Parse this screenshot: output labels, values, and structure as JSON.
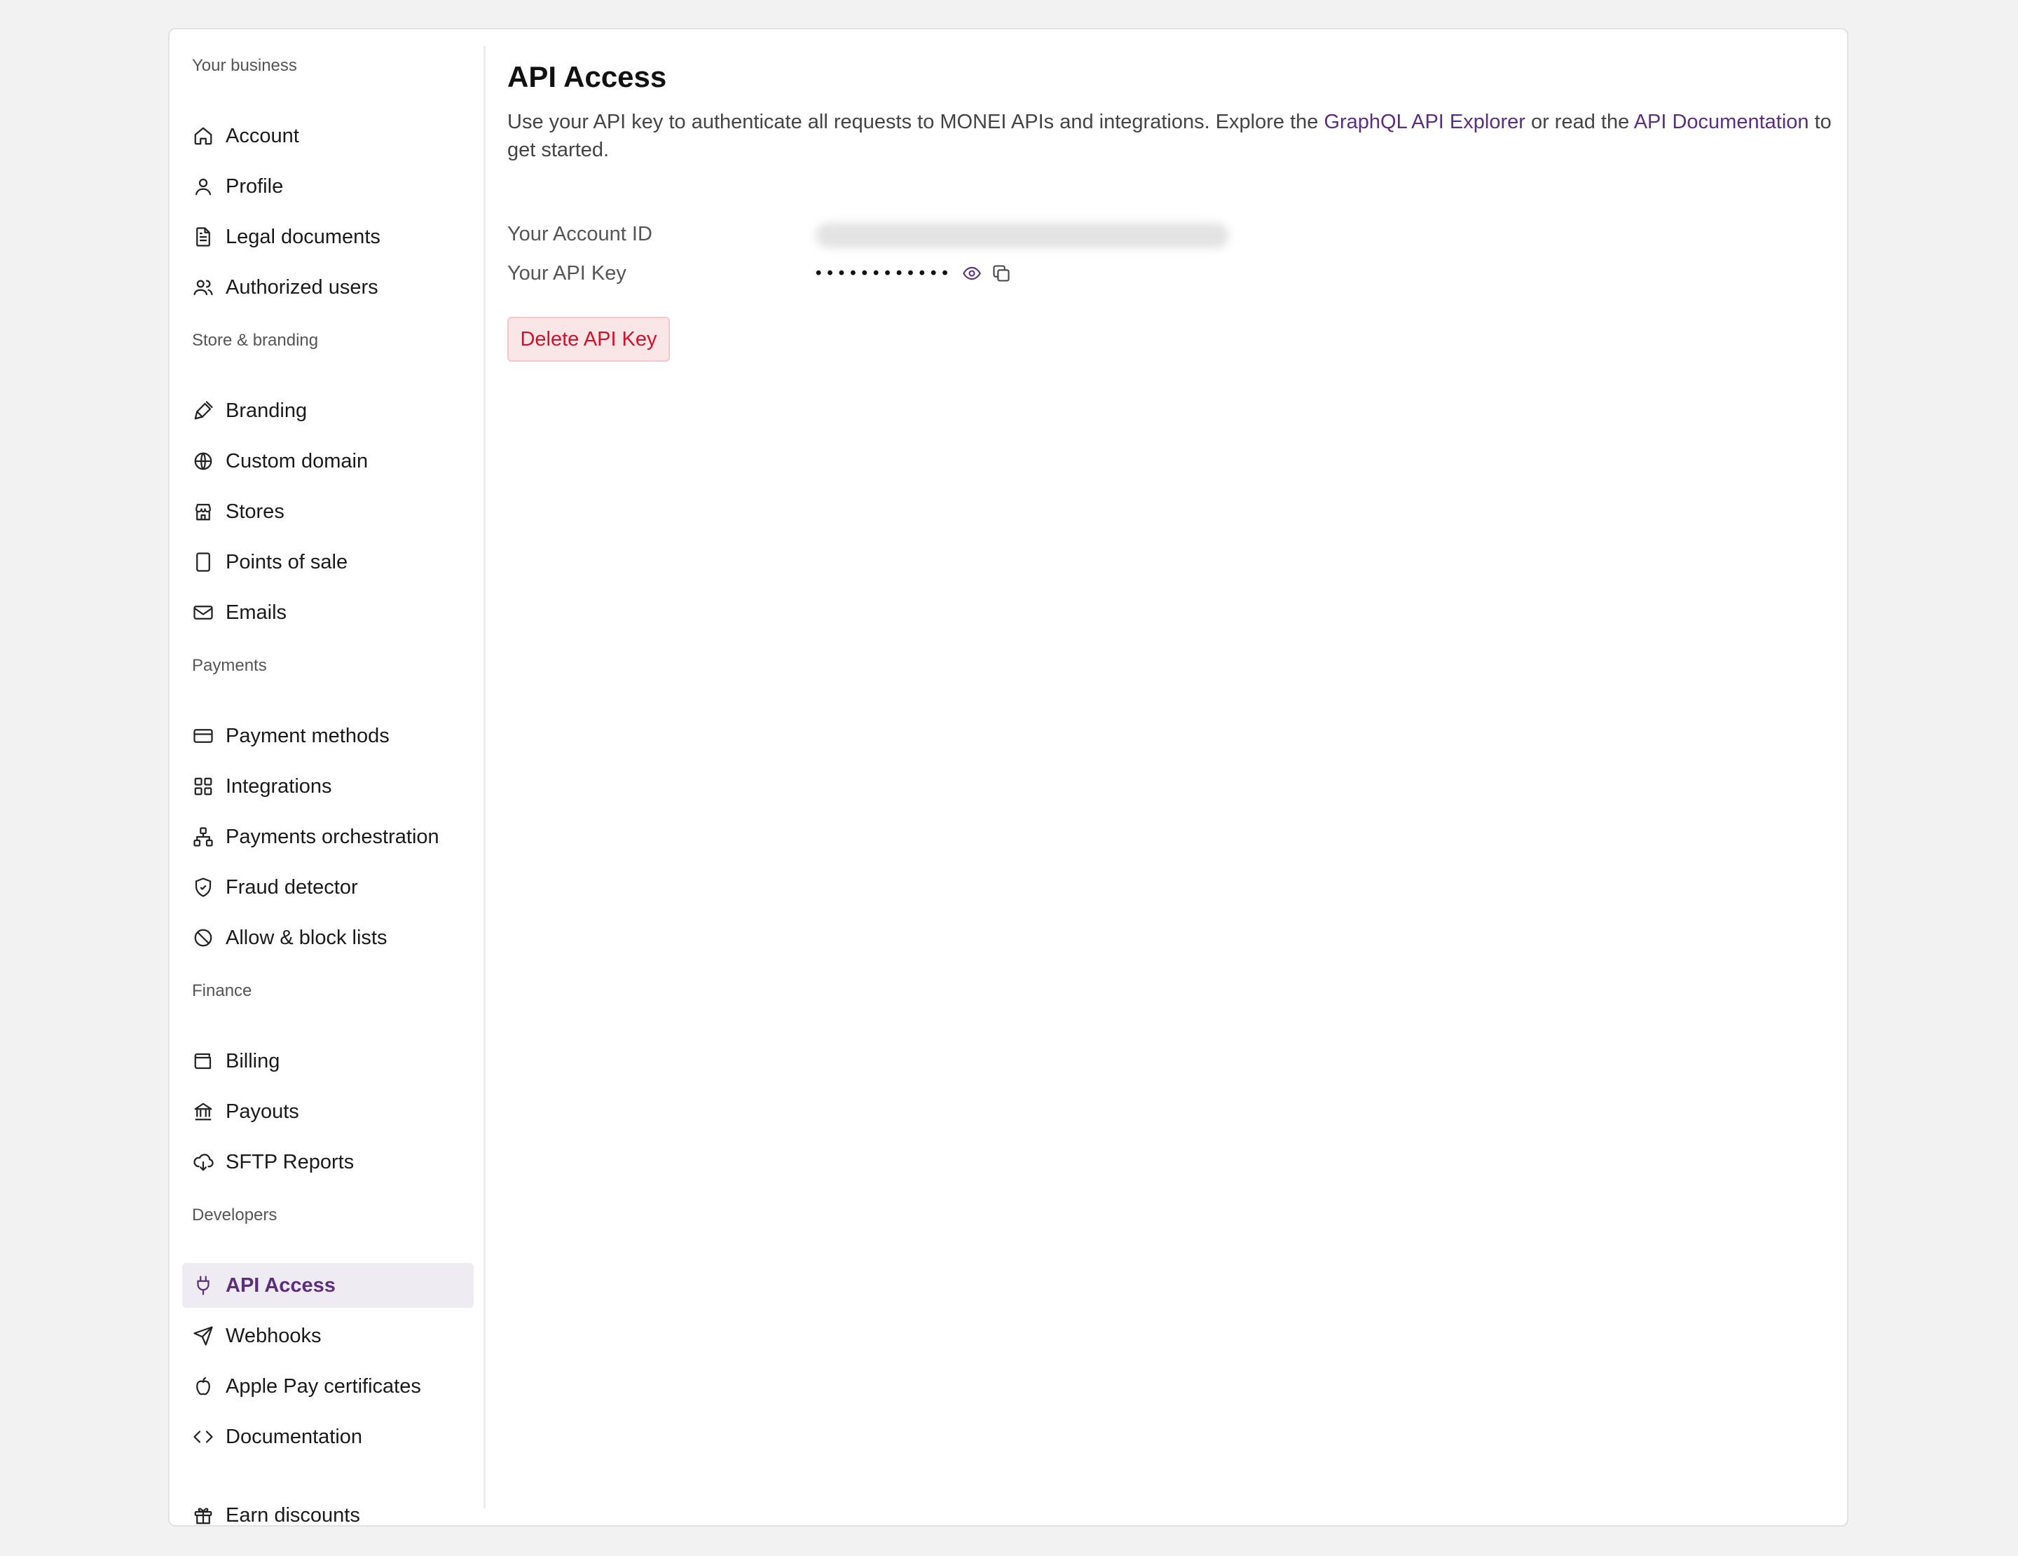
{
  "sidebar": {
    "sections": [
      {
        "label": "Your business",
        "items": [
          {
            "label": "Account",
            "icon": "home-icon"
          },
          {
            "label": "Profile",
            "icon": "user-icon"
          },
          {
            "label": "Legal documents",
            "icon": "document-icon"
          },
          {
            "label": "Authorized users",
            "icon": "users-icon"
          }
        ]
      },
      {
        "label": "Store & branding",
        "items": [
          {
            "label": "Branding",
            "icon": "paintbrush-icon"
          },
          {
            "label": "Custom domain",
            "icon": "globe-icon"
          },
          {
            "label": "Stores",
            "icon": "store-icon"
          },
          {
            "label": "Points of sale",
            "icon": "tablet-icon"
          },
          {
            "label": "Emails",
            "icon": "mail-icon"
          }
        ]
      },
      {
        "label": "Payments",
        "items": [
          {
            "label": "Payment methods",
            "icon": "credit-card-icon"
          },
          {
            "label": "Integrations",
            "icon": "grid-icon"
          },
          {
            "label": "Payments orchestration",
            "icon": "network-icon"
          },
          {
            "label": "Fraud detector",
            "icon": "shield-check-icon"
          },
          {
            "label": "Allow & block lists",
            "icon": "ban-icon"
          }
        ]
      },
      {
        "label": "Finance",
        "items": [
          {
            "label": "Billing",
            "icon": "wallet-icon"
          },
          {
            "label": "Payouts",
            "icon": "bank-icon"
          },
          {
            "label": "SFTP Reports",
            "icon": "cloud-download-icon"
          }
        ]
      },
      {
        "label": "Developers",
        "items": [
          {
            "label": "API Access",
            "icon": "plug-icon",
            "active": true
          },
          {
            "label": "Webhooks",
            "icon": "send-icon"
          },
          {
            "label": "Apple Pay certificates",
            "icon": "apple-icon"
          },
          {
            "label": "Documentation",
            "icon": "code-icon"
          }
        ]
      }
    ],
    "footer_item": {
      "label": "Earn discounts",
      "icon": "gift-icon"
    }
  },
  "main": {
    "title": "API Access",
    "description": {
      "part1": "Use your API key to authenticate all requests to MONEI APIs and integrations. Explore the ",
      "link1": "GraphQL API Explorer",
      "part2": " or read the ",
      "link2": "API Documentation",
      "part3": " to get started."
    },
    "account_id_label": "Your Account ID",
    "api_key_label": "Your API Key",
    "api_key_masked": "••••••••••••",
    "api_key_reveal_icon": "eye-icon",
    "api_key_copy_icon": "copy-icon",
    "delete_button": "Delete API Key"
  },
  "colors": {
    "accent": "#5b2f7c",
    "active_bg": "#efebf3",
    "danger": "#d3102a",
    "danger_bg": "#fbe6e7"
  }
}
